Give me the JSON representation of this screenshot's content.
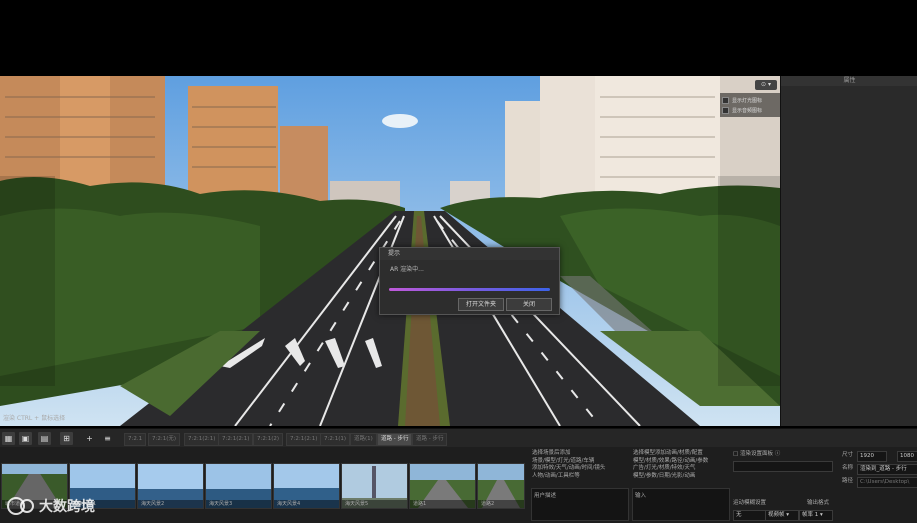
{
  "viewport": {
    "overlay_items": [
      "显示灯光图标",
      "显示音频图标"
    ],
    "view_button": "⊙ ▾"
  },
  "right_panel": {
    "header": "属性"
  },
  "dialog": {
    "title": "提示",
    "message": "AR 渲染中...",
    "progress": 1.0,
    "open_folder_label": "打开文件夹",
    "close_label": "关闭"
  },
  "status_line": "渲染    CTRL + 鼠标选择",
  "toolbar": {
    "icons": [
      "grid-icon",
      "image-icon",
      "layers-icon",
      "export-icon",
      "add-icon",
      "list-icon"
    ],
    "icon_glyphs": [
      "▦",
      "▣",
      "▤",
      "⊞",
      "+",
      "≡"
    ],
    "tabs": [
      "7:2.1",
      "7:2:1(无)",
      "7:2:1(2:1)",
      "7:2:1(2:1)",
      "7:2:1(2)",
      "7:2:1(2:1)",
      "7:2:1(1)",
      "道路(1)",
      "道路 - 步行",
      "道路 - 步行"
    ],
    "active_tab": 8
  },
  "thumbnails": [
    {
      "caption": "城市道路",
      "scene": "road"
    },
    {
      "caption": "海天风景1",
      "scene": "sea"
    },
    {
      "caption": "海天风景2",
      "scene": "sea"
    },
    {
      "caption": "海天风景3",
      "scene": "sea"
    },
    {
      "caption": "海天风景4",
      "scene": "sea"
    },
    {
      "caption": "海天风景5",
      "scene": "pole"
    },
    {
      "caption": "道路1",
      "scene": "road2"
    },
    {
      "caption": "道路2",
      "scene": "road2"
    }
  ],
  "hints_left": {
    "title": "选择场景后添加",
    "lines": [
      "场景/模型/灯光/道路/车辆",
      "添加特效/天气/动画/时间/镜头",
      "人物/动画/工具栏等"
    ],
    "box_text": "用户描述"
  },
  "hints_mid": {
    "title": "选择模型添加动画/材质/配置",
    "lines": [
      "模型/材质/效果/路径/动画/参数",
      "广告/灯光/材质/特效/天气",
      "模型/参数/日期/光影/动画"
    ],
    "box_text": "输入"
  },
  "settings": {
    "checkbox_label": "□ 渲染设置面板 ⓘ",
    "size_label": "尺寸",
    "width": "1920",
    "height": "1080",
    "name_label": "名称",
    "name_value": "渲染到_道路 - 步行",
    "path_label": "路径",
    "path_value": "C:\\Users\\Desktop\\",
    "quality_label": "运动模糊设置",
    "quality_value": "无",
    "mode_label": "输出格式",
    "mode_value": "视频帧 ▾",
    "fps_value": "帧率 1 ▾"
  },
  "watermark": "大数跨境"
}
